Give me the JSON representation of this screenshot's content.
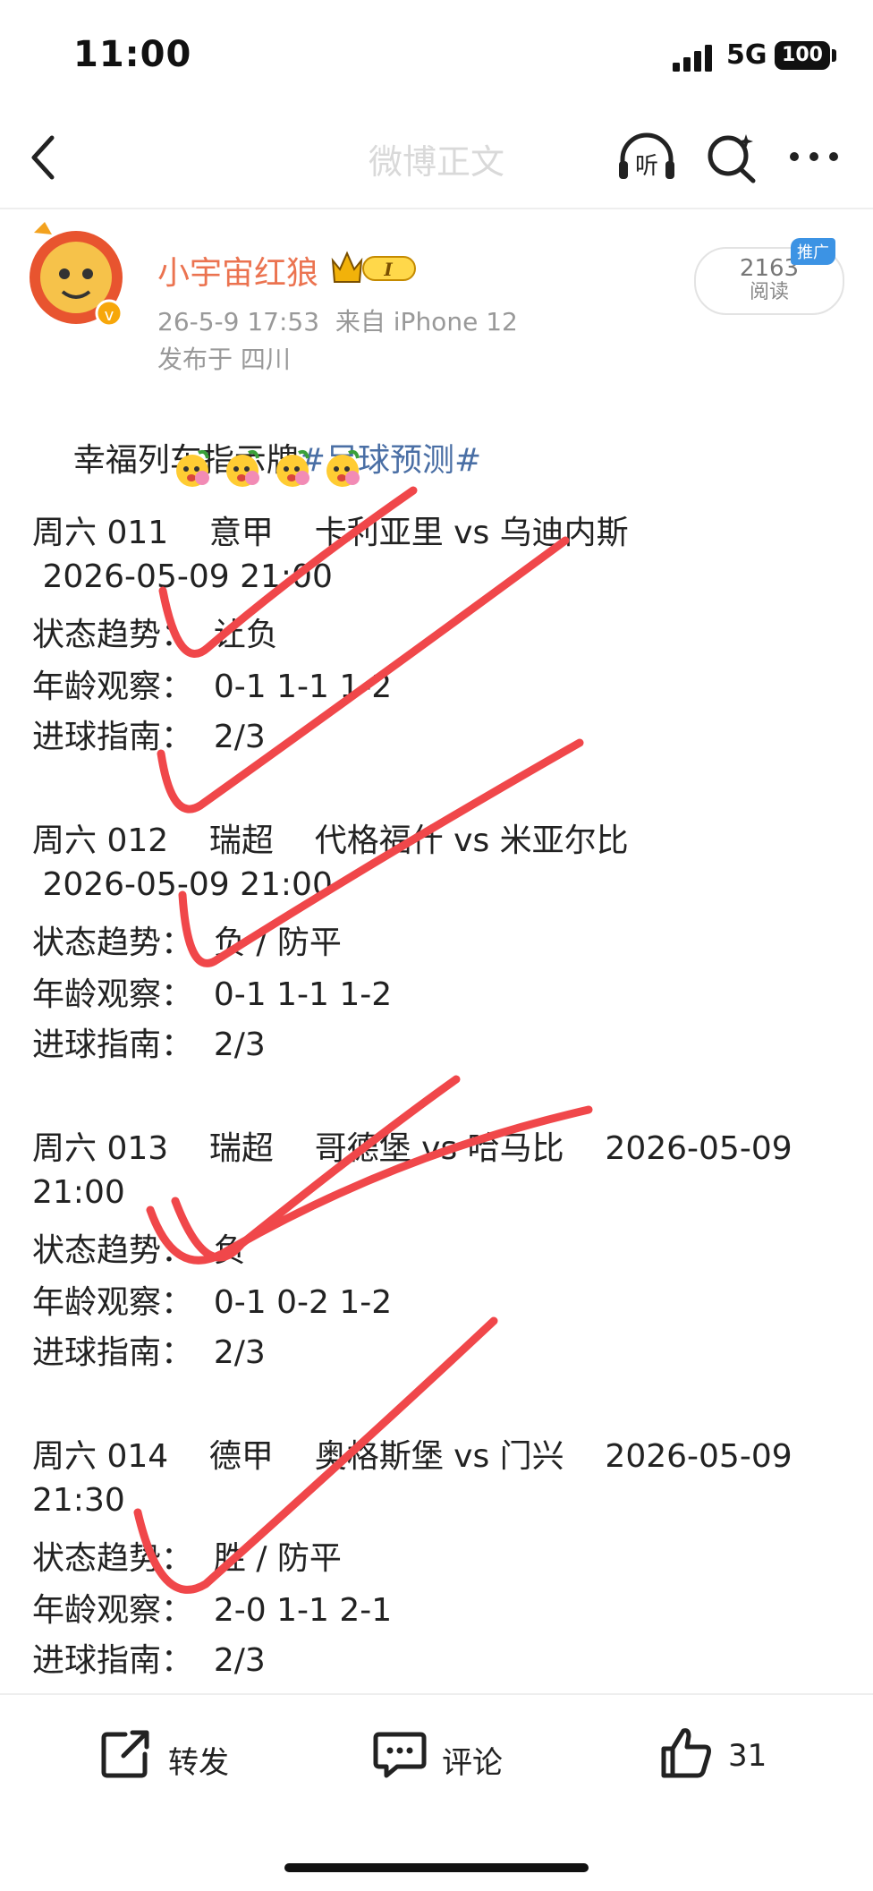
{
  "status_bar": {
    "time": "11:00",
    "network": "5G",
    "battery": "100"
  },
  "nav": {
    "title": "微博正文",
    "listen_label": "听"
  },
  "post": {
    "author": "小宇宙红狼",
    "level_badge": "I",
    "date_time": "26-5-9 17:53",
    "source": "来自 iPhone 12",
    "location": "发布于 四川",
    "reads_count": "2163",
    "reads_label": "阅读",
    "promo_tag": "推广",
    "title_text": "幸福列车指示牌",
    "hashtag": "#足球预测#",
    "emoji_icon": "flower-emoji"
  },
  "matches": [
    {
      "header": "周六 011    意甲    卡利亚里 vs 乌迪内斯",
      "time": " 2026-05-09 21:00",
      "trend": "状态趋势：  让负",
      "age": "年龄观察：  0-1 1-1 1-2",
      "goals": "进球指南：  2/3"
    },
    {
      "header": "周六 012    瑞超    代格福什 vs 米亚尔比",
      "time": " 2026-05-09 21:00",
      "trend": "状态趋势：  负 / 防平",
      "age": "年龄观察：  0-1 1-1 1-2",
      "goals": "进球指南：  2/3"
    },
    {
      "header": "周六 013    瑞超    哥德堡 vs 哈马比    2026-05-09",
      "time": "21:00",
      "trend": "状态趋势：  负",
      "age": "年龄观察：  0-1 0-2 1-2",
      "goals": "进球指南：  2/3"
    },
    {
      "header": "周六 014    德甲    奥格斯堡 vs 门兴    2026-05-09",
      "time": "21:30",
      "trend": "状态趋势：  胜 / 防平",
      "age": "年龄观察：  2-0 1-1 2-1",
      "goals": "进球指南：  2/3"
    }
  ],
  "actions": {
    "repost_label": "转发",
    "comment_label": "评论",
    "like_count": "31"
  },
  "colors": {
    "username": "#eb7350",
    "hashtag": "#4a6fa5",
    "tick_marks": "#f0474a",
    "meta": "#999999"
  }
}
